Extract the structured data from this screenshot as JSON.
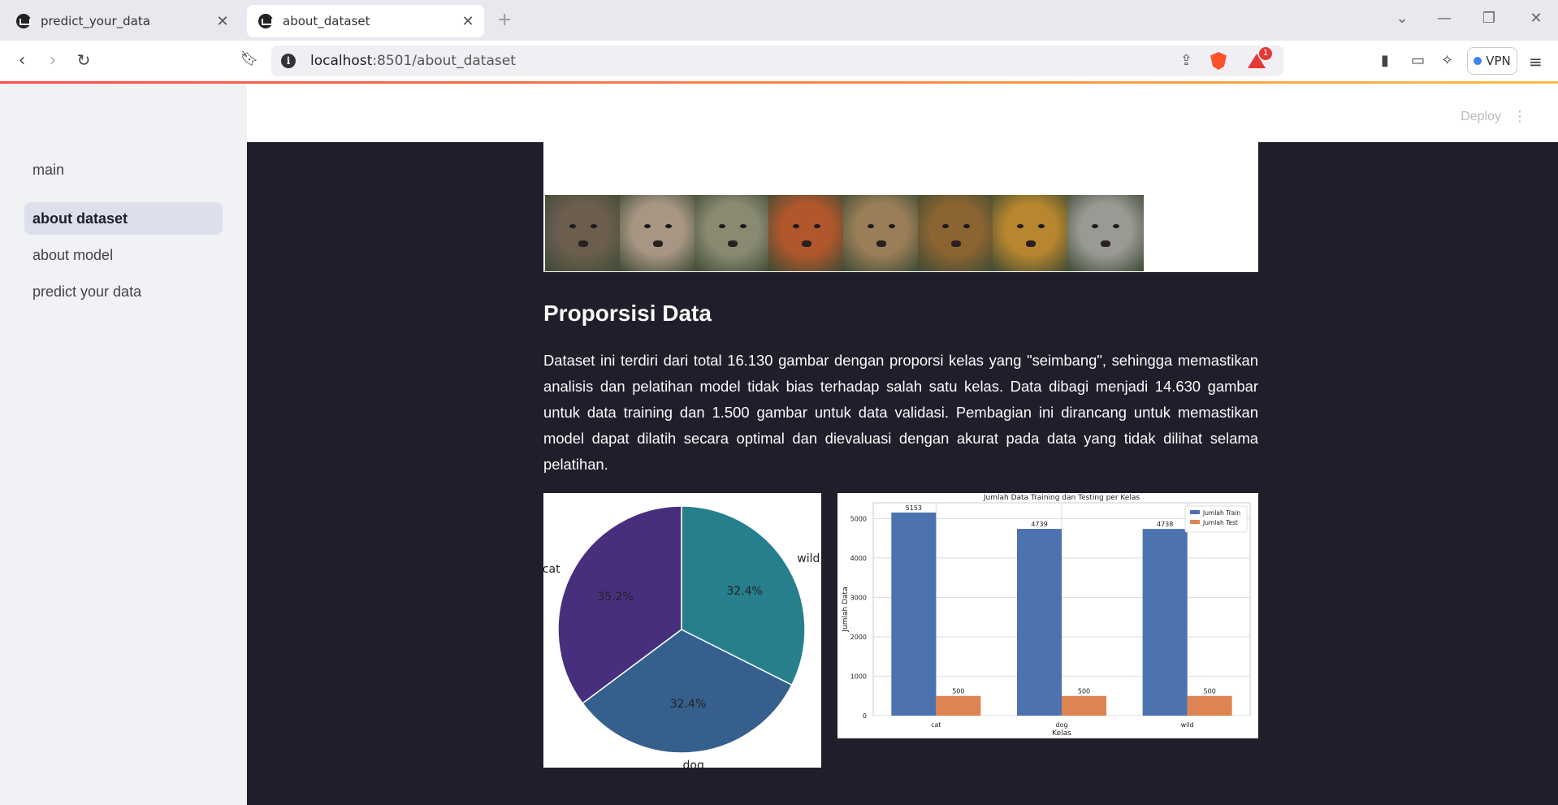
{
  "browser": {
    "tabs": [
      {
        "title": "predict_your_data",
        "active": false
      },
      {
        "title": "about_dataset",
        "active": true
      }
    ],
    "url_host": "localhost",
    "url_rest": ":8501/about_dataset",
    "notification_count": "1",
    "vpn_label": "VPN"
  },
  "sidebar": {
    "items": [
      {
        "label": "main"
      },
      {
        "label": "about dataset",
        "selected": true
      },
      {
        "label": "about model"
      },
      {
        "label": "predict your data"
      }
    ]
  },
  "header": {
    "deploy_label": "Deploy"
  },
  "main": {
    "section_title": "Proporsisi Data",
    "paragraph": "Dataset ini terdiri dari total 16.130 gambar dengan proporsi kelas yang \"seimbang\", sehingga memastikan analisis dan pelatihan model tidak bias terhadap salah satu kelas. Data dibagi menjadi 14.630 gambar untuk data training dan 1.500 gambar untuk data validasi. Pembagian ini dirancang untuk memastikan model dapat dilatih secara optimal dan dievaluasi dengan akurat pada data yang tidak dilihat selama pelatihan."
  },
  "chart_data": [
    {
      "type": "pie",
      "labels": [
        "cat",
        "dog",
        "wild"
      ],
      "percent_labels": [
        "35.2%",
        "32.4%",
        "32.4%"
      ],
      "values": [
        35.2,
        32.4,
        32.4
      ],
      "colors": [
        "#472f7d",
        "#355f8d",
        "#277f8e"
      ]
    },
    {
      "type": "bar",
      "title": "Jumlah Data Training dan Testing per Kelas",
      "xlabel": "Kelas",
      "ylabel": "Jumlah Data",
      "categories": [
        "cat",
        "dog",
        "wild"
      ],
      "series": [
        {
          "name": "Jumlah Train",
          "values": [
            5153,
            4739,
            4738
          ],
          "color": "#4c72b0"
        },
        {
          "name": "Jumlah Test",
          "values": [
            500,
            500,
            500
          ],
          "color": "#dd8452"
        }
      ],
      "yticks": [
        0,
        1000,
        2000,
        3000,
        4000,
        5000
      ],
      "ylim": [
        0,
        5400
      ],
      "grid": true,
      "legend": "top-right"
    }
  ],
  "gallery": {
    "images": [
      {
        "name": "wolf",
        "color": "#6b5e4e"
      },
      {
        "name": "lioness",
        "color": "#a89684"
      },
      {
        "name": "snow-leopard",
        "color": "#8a8a72"
      },
      {
        "name": "fox",
        "color": "#b0572c"
      },
      {
        "name": "lion-cub",
        "color": "#9a7e58"
      },
      {
        "name": "lion",
        "color": "#8c6432"
      },
      {
        "name": "lioness-2",
        "color": "#b8862e"
      },
      {
        "name": "gray-wolf",
        "color": "#9a9a94"
      }
    ]
  }
}
